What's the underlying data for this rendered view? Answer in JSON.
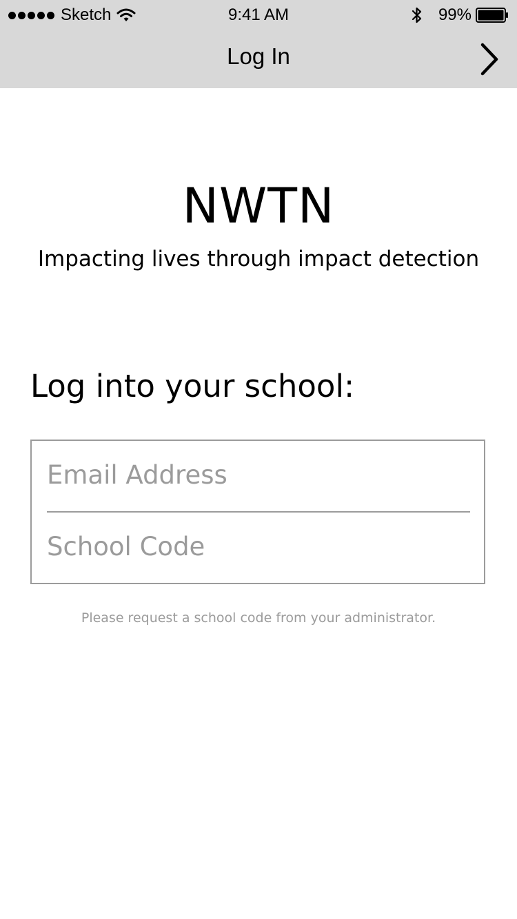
{
  "status_bar": {
    "carrier": "Sketch",
    "time": "9:41 AM",
    "battery_percent": "99%",
    "signal_icon": "signal-dots-icon",
    "wifi_icon": "wifi-icon",
    "bluetooth_icon": "bluetooth-icon",
    "battery_icon": "battery-icon"
  },
  "nav": {
    "title": "Log In",
    "next_icon": "chevron-right-icon"
  },
  "brand": {
    "title": "NWTN",
    "tagline": "Impacting lives through impact detection"
  },
  "login": {
    "heading": "Log into your school:",
    "email_placeholder": "Email Address",
    "email_value": "",
    "code_placeholder": "School Code",
    "code_value": "",
    "help_text": "Please request a school code from your administrator."
  },
  "colors": {
    "header_background": "#d8d8d8",
    "border_gray": "#9b9b9b",
    "placeholder_gray": "#9b9b9b",
    "text": "#000000",
    "background": "#ffffff"
  }
}
